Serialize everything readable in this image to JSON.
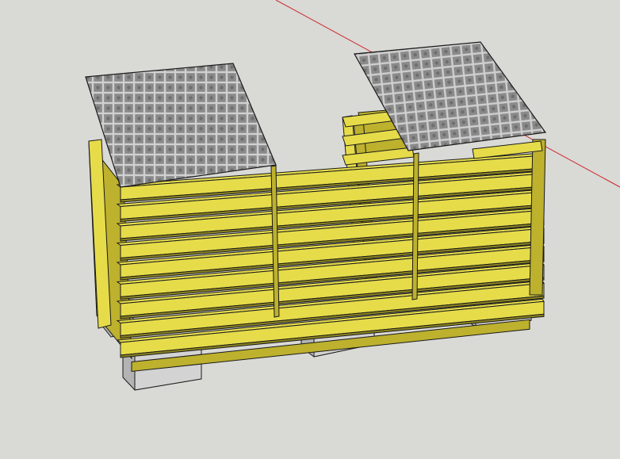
{
  "app": {
    "type": "3d-modeling-viewport"
  },
  "viewport": {
    "background_color": "#d9d9d6",
    "axis_color": "#cc2a2a"
  },
  "model": {
    "name": "",
    "wood_color": "#e6dc4a",
    "wood_shade": "#bdb12e",
    "wood_dark": "#8c8420",
    "block_color": "#d4d4d4",
    "block_side": "#b5b5b5",
    "lid_color": "#8c8c8c",
    "edge_color": "#1a1a1a"
  }
}
